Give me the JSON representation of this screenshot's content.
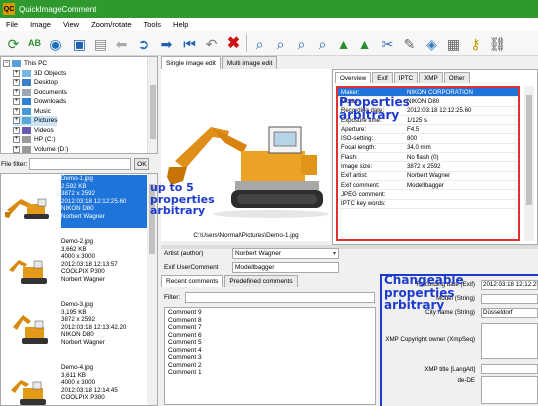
{
  "window": {
    "title": "QuickImageComment",
    "app_icon": "QC"
  },
  "menu": [
    "File",
    "Image",
    "View",
    "Zoom/rotate",
    "Tools",
    "Help"
  ],
  "tree": [
    {
      "label": "This PC",
      "level": 0
    },
    {
      "label": "3D Objects",
      "level": 1
    },
    {
      "label": "Desktop",
      "level": 1
    },
    {
      "label": "Documents",
      "level": 1
    },
    {
      "label": "Downloads",
      "level": 1
    },
    {
      "label": "Music",
      "level": 1
    },
    {
      "label": "Pictures",
      "level": 1
    },
    {
      "label": "Videos",
      "level": 1
    },
    {
      "label": "HP (C:)",
      "level": 1
    },
    {
      "label": "Volume (D:)",
      "level": 1
    }
  ],
  "file_filter": {
    "label": "File filter:",
    "button": "OK"
  },
  "thumbnails": [
    {
      "lines": [
        "Demo-1.jpg",
        "2,592 KB",
        "3872 x 2592",
        "2012:03:18 12:12:25.60",
        "NIKON D80",
        "Norbert Wagner"
      ],
      "selected": true
    },
    {
      "lines": [
        "Demo-2.jpg",
        "3,662 KB",
        "4000 x 3000",
        "2012:03:18 12:13:57",
        "COOLPIX P300",
        "Norbert Wagner"
      ],
      "selected": false
    },
    {
      "lines": [
        "Demo-3.jpg",
        "3,195 KB",
        "3872 x 2592",
        "2012:03:18 12:13:42.20",
        "NIKON D80",
        "Norbert Wagner"
      ],
      "selected": false
    },
    {
      "lines": [
        "Demo-4.jpg",
        "3,611 KB",
        "4000 x 3000",
        "2012:03:18 12:14:45",
        "COOLPIX P300"
      ],
      "selected": false
    }
  ],
  "edit_tabs": [
    "Single image edit",
    "Multi image edit"
  ],
  "image_path": "C:\\Users\\Normal\\Pictures\\Demo-1.jpg",
  "meta_tabs": [
    "Overview",
    "Exif",
    "IPTC",
    "XMP",
    "Other"
  ],
  "metadata": [
    {
      "key": "Maker:",
      "value": "NIKON CORPORATION"
    },
    {
      "key": "Model:",
      "value": "NIKON D80"
    },
    {
      "key": "Recording date:",
      "value": "2012:03:18 12:12:25.60"
    },
    {
      "key": "Exposure time:",
      "value": "1/125 s"
    },
    {
      "key": "Aperture:",
      "value": "F4.5"
    },
    {
      "key": "ISO-setting:",
      "value": "800"
    },
    {
      "key": "Focal length:",
      "value": "34.0 mm"
    },
    {
      "key": "Flash:",
      "value": "No flash (0)"
    },
    {
      "key": "Image size:",
      "value": "3872 x 2592"
    },
    {
      "key": "Exif artist:",
      "value": "Norbert Wagner"
    },
    {
      "key": "Exif comment:",
      "value": "Modellbagger"
    },
    {
      "key": "JPEG comment:",
      "value": ""
    },
    {
      "key": "IPTC key words:",
      "value": ""
    }
  ],
  "artist": {
    "label": "Artist (author)",
    "value": "Norbert Wagner"
  },
  "usercomment": {
    "label": "Exif UserComment",
    "value": "Modellbagger"
  },
  "comment_tabs": [
    "Recent comments",
    "Predefined comments"
  ],
  "comment_filter_label": "Filter:",
  "comments": [
    "Comment 9",
    "Comment 8",
    "Comment 7",
    "Comment 6",
    "Comment 5",
    "Comment 4",
    "Comment 3",
    "Comment 2",
    "Comment 1"
  ],
  "properties": [
    {
      "key": "Recording date (Exif)",
      "value": "2012:03:18 12:12:25.60"
    },
    {
      "key": "Model (String)",
      "value": ""
    },
    {
      "key": "City name (String)",
      "value": "Düsseldorf"
    },
    {
      "key": "XMP Copyright owner (XmpSeq)",
      "value": ""
    },
    {
      "key": "XMP title [LangAlt]",
      "value": ""
    },
    {
      "key": "de-DE",
      "value": ""
    }
  ],
  "annotations": {
    "thumbs": "up to 5 properties arbitrary",
    "overview": "Properties arbitrary",
    "changeable": "Changeable properties arbitrary"
  },
  "colors": {
    "titlebar": "#2e9a2e",
    "selection": "#1e74d8",
    "annotation": "#1d3bcc",
    "grid_border": "#e03030"
  }
}
